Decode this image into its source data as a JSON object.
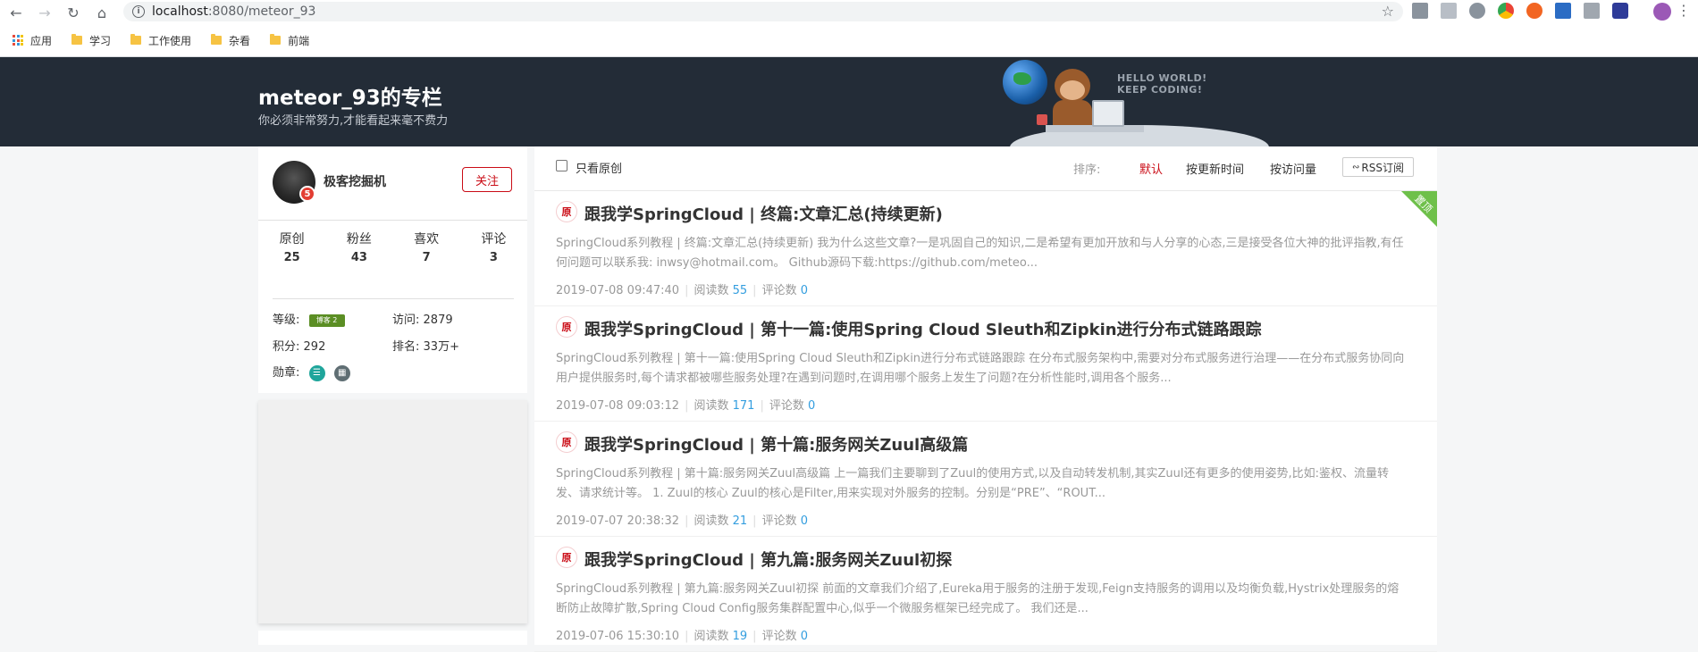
{
  "browser": {
    "url_host": "localhost",
    "url_path": ":8080/meteor_93",
    "bookmarks": [
      "应用",
      "学习",
      "工作使用",
      "杂看",
      "前端"
    ]
  },
  "banner": {
    "title": "meteor_93的专栏",
    "subtitle": "你必须非常努力,才能看起来毫不费力",
    "hello_line1": "HELLO WORLD!",
    "hello_line2": "KEEP CODING!"
  },
  "profile": {
    "name": "极客挖掘机",
    "avatar_badge": "5",
    "follow_label": "关注",
    "stats": [
      {
        "label": "原创",
        "value": "25"
      },
      {
        "label": "粉丝",
        "value": "43"
      },
      {
        "label": "喜欢",
        "value": "7"
      },
      {
        "label": "评论",
        "value": "3"
      }
    ],
    "level_label": "等级:",
    "level_badge": "博客 2",
    "visits_label": "访问:",
    "visits_value": "2879",
    "points_label": "积分:",
    "points_value": "292",
    "rank_label": "排名:",
    "rank_value": "33万+",
    "medals_label": "勋章:"
  },
  "toolbar": {
    "original_only": "只看原创",
    "sort_label": "排序:",
    "sort_default": "默认",
    "sort_updated": "按更新时间",
    "sort_visits": "按访问量",
    "rss": "RSS订阅"
  },
  "articles": [
    {
      "tag": "原",
      "title": "跟我学SpringCloud | 终篇:文章汇总(持续更新)",
      "desc": "SpringCloud系列教程 | 终篇:文章汇总(持续更新) 我为什么这些文章?一是巩固自己的知识,二是希望有更加开放和与人分享的心态,三是接受各位大神的批评指教,有任何问题可以联系我: inwsy@hotmail.com。 Github源码下载:https://github.com/meteo...",
      "date": "2019-07-08 09:47:40",
      "reads_label": "阅读数",
      "reads": "55",
      "comments_label": "评论数",
      "comments": "0",
      "pinned": "置顶"
    },
    {
      "tag": "原",
      "title": "跟我学SpringCloud | 第十一篇:使用Spring Cloud Sleuth和Zipkin进行分布式链路跟踪",
      "desc": "SpringCloud系列教程 | 第十一篇:使用Spring Cloud Sleuth和Zipkin进行分布式链路跟踪 在分布式服务架构中,需要对分布式服务进行治理——在分布式服务协同向用户提供服务时,每个请求都被哪些服务处理?在遇到问题时,在调用哪个服务上发生了问题?在分析性能时,调用各个服务...",
      "date": "2019-07-08 09:03:12",
      "reads_label": "阅读数",
      "reads": "171",
      "comments_label": "评论数",
      "comments": "0"
    },
    {
      "tag": "原",
      "title": "跟我学SpringCloud | 第十篇:服务网关Zuul高级篇",
      "desc": "SpringCloud系列教程 | 第十篇:服务网关Zuul高级篇 上一篇我们主要聊到了Zuul的使用方式,以及自动转发机制,其实Zuul还有更多的使用姿势,比如:鉴权、流量转发、请求统计等。 1. Zuul的核心 Zuul的核心是Filter,用来实现对外服务的控制。分别是“PRE”、“ROUT...",
      "date": "2019-07-07 20:38:32",
      "reads_label": "阅读数",
      "reads": "21",
      "comments_label": "评论数",
      "comments": "0"
    },
    {
      "tag": "原",
      "title": "跟我学SpringCloud | 第九篇:服务网关Zuul初探",
      "desc": "SpringCloud系列教程 | 第九篇:服务网关Zuul初探 前面的文章我们介绍了,Eureka用于服务的注册于发现,Feign支持服务的调用以及均衡负载,Hystrix处理服务的熔断防止故障扩散,Spring Cloud Config服务集群配置中心,似乎一个微服务框架已经完成了。 我们还是...",
      "date": "2019-07-06 15:30:10",
      "reads_label": "阅读数",
      "reads": "19",
      "comments_label": "评论数",
      "comments": "0"
    }
  ]
}
